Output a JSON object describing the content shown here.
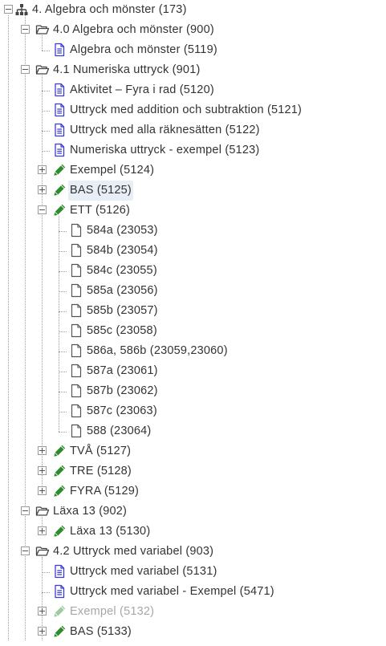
{
  "colors": {
    "doc_icon": "#3a3ad6",
    "pencil_icon": "#2e8b2e",
    "folder_icon": "#444444",
    "file_icon": "#555555",
    "tree_lines": "#9c9c9c",
    "highlight_bg": "#e8eef5",
    "dimmed_text": "#a7a7a7"
  },
  "tree": {
    "nodes": [
      {
        "label": "4. Algebra och mönster (173)",
        "icon": "sitemap-icon",
        "toggle": "minus"
      },
      {
        "label": "4.0 Algebra och mönster (900)",
        "icon": "folder-open-icon",
        "toggle": "minus"
      },
      {
        "label": "Algebra och mönster (5119)",
        "icon": "document-icon",
        "toggle": "none"
      },
      {
        "label": "4.1 Numeriska uttryck (901)",
        "icon": "folder-open-icon",
        "toggle": "minus"
      },
      {
        "label": "Aktivitet – Fyra i rad (5120)",
        "icon": "document-icon",
        "toggle": "none"
      },
      {
        "label": "Uttryck med addition och subtraktion (5121)",
        "icon": "document-icon",
        "toggle": "none"
      },
      {
        "label": "Uttryck med alla räknesätten (5122)",
        "icon": "document-icon",
        "toggle": "none"
      },
      {
        "label": "Numeriska uttryck - exempel (5123)",
        "icon": "document-icon",
        "toggle": "none"
      },
      {
        "label": "Exempel (5124)",
        "icon": "pencil-icon",
        "toggle": "plus"
      },
      {
        "label": "BAS (5125)",
        "icon": "pencil-icon",
        "toggle": "plus",
        "highlighted": true
      },
      {
        "label": "ETT (5126)",
        "icon": "pencil-icon",
        "toggle": "minus"
      },
      {
        "label": "584a (23053)",
        "icon": "file-icon",
        "toggle": "none"
      },
      {
        "label": "584b (23054)",
        "icon": "file-icon",
        "toggle": "none"
      },
      {
        "label": "584c (23055)",
        "icon": "file-icon",
        "toggle": "none"
      },
      {
        "label": "585a (23056)",
        "icon": "file-icon",
        "toggle": "none"
      },
      {
        "label": "585b (23057)",
        "icon": "file-icon",
        "toggle": "none"
      },
      {
        "label": "585c (23058)",
        "icon": "file-icon",
        "toggle": "none"
      },
      {
        "label": "586a, 586b (23059,23060)",
        "icon": "file-icon",
        "toggle": "none"
      },
      {
        "label": "587a (23061)",
        "icon": "file-icon",
        "toggle": "none"
      },
      {
        "label": "587b (23062)",
        "icon": "file-icon",
        "toggle": "none"
      },
      {
        "label": "587c (23063)",
        "icon": "file-icon",
        "toggle": "none"
      },
      {
        "label": "588 (23064)",
        "icon": "file-icon",
        "toggle": "none"
      },
      {
        "label": "TVÅ (5127)",
        "icon": "pencil-icon",
        "toggle": "plus"
      },
      {
        "label": "TRE (5128)",
        "icon": "pencil-icon",
        "toggle": "plus"
      },
      {
        "label": "FYRA (5129)",
        "icon": "pencil-icon",
        "toggle": "plus"
      },
      {
        "label": "Läxa 13 (902)",
        "icon": "folder-open-icon",
        "toggle": "minus"
      },
      {
        "label": "Läxa 13 (5130)",
        "icon": "pencil-icon",
        "toggle": "plus"
      },
      {
        "label": "4.2 Uttryck med variabel (903)",
        "icon": "folder-open-icon",
        "toggle": "minus"
      },
      {
        "label": "Uttryck med variabel (5131)",
        "icon": "document-icon",
        "toggle": "none"
      },
      {
        "label": "Uttryck med variabel - Exempel (5471)",
        "icon": "document-icon",
        "toggle": "none"
      },
      {
        "label": "Exempel (5132)",
        "icon": "pencil-icon",
        "toggle": "plus",
        "dimmed": true
      },
      {
        "label": "BAS (5133)",
        "icon": "pencil-icon",
        "toggle": "plus"
      }
    ]
  }
}
